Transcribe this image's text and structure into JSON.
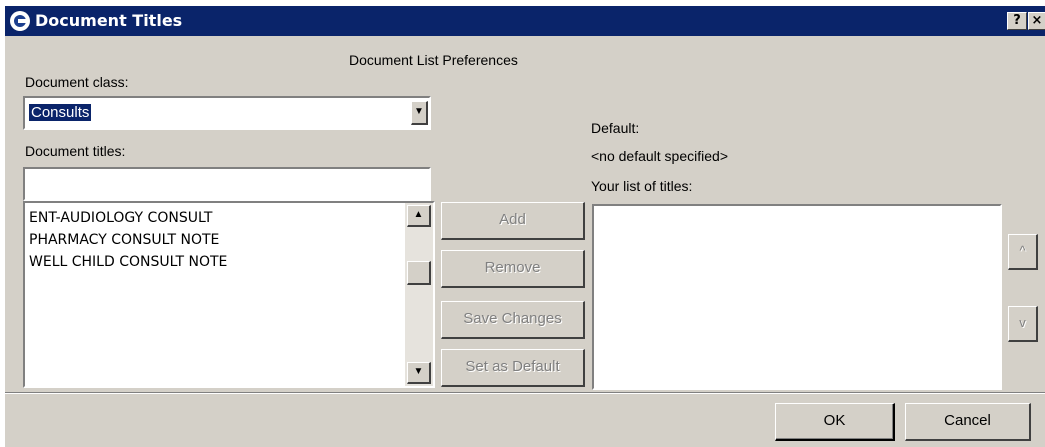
{
  "window": {
    "title": "Document Titles",
    "help_glyph": "?",
    "close_glyph": "×",
    "app_icon": "app-logo-icon"
  },
  "preferences": {
    "heading": "Document List Preferences"
  },
  "document_class": {
    "label": "Document class:",
    "selected": "Consults",
    "dropdown_glyph": "▼"
  },
  "document_titles": {
    "label": "Document titles:",
    "filter_value": "",
    "items": [
      "ENT-AUDIOLOGY CONSULT",
      "PHARMACY CONSULT NOTE",
      "WELL CHILD CONSULT NOTE"
    ],
    "scroll_up_glyph": "▲",
    "scroll_down_glyph": "▼"
  },
  "actions": {
    "add": "Add",
    "remove": "Remove",
    "save_changes": "Save Changes",
    "set_as_default": "Set as Default"
  },
  "default": {
    "label": "Default:",
    "value": "<no default specified>"
  },
  "your_titles": {
    "label": "Your list of titles:",
    "items": [],
    "move_up_glyph": "^",
    "move_down_glyph": "v"
  },
  "footer": {
    "ok": "OK",
    "cancel": "Cancel"
  },
  "colors": {
    "titlebar": "#0a246a",
    "dialog_face": "#d4d0c8",
    "selection": "#0a246a"
  }
}
